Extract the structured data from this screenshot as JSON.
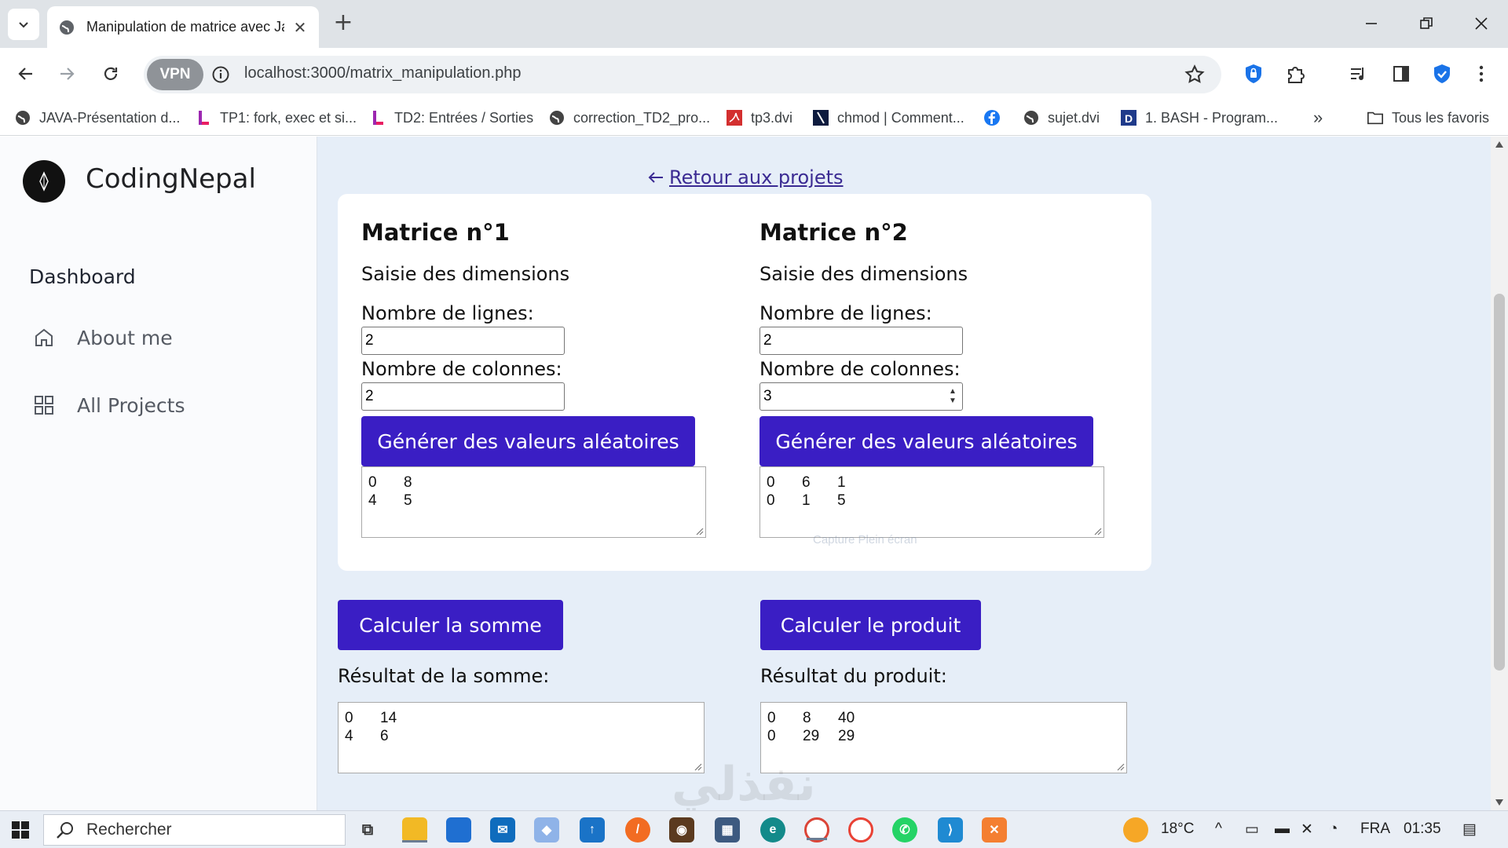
{
  "browser": {
    "tab_title": "Manipulation de matrice avec Já",
    "url": "localhost:3000/matrix_manipulation.php",
    "vpn_label": "VPN",
    "bookmarks": [
      {
        "label": "JAVA-Présentation d...",
        "icon": "globe-icon"
      },
      {
        "label": "TP1: fork, exec et si...",
        "icon": "bookmark-pink-icon"
      },
      {
        "label": "TD2: Entrées / Sorties",
        "icon": "bookmark-pink-icon"
      },
      {
        "label": "correction_TD2_pro...",
        "icon": "globe-icon"
      },
      {
        "label": "tp3.dvi",
        "icon": "pdf-icon"
      },
      {
        "label": "chmod | Comment...",
        "icon": "backslash-icon"
      },
      {
        "label": "",
        "icon": "facebook-icon"
      },
      {
        "label": "sujet.dvi",
        "icon": "globe-icon"
      },
      {
        "label": "1. BASH - Program...",
        "icon": "d-icon"
      }
    ],
    "more_bookmarks": "»",
    "all_favorites": "Tous les favoris"
  },
  "sidebar": {
    "brand": "CodingNepal",
    "heading": "Dashboard",
    "items": [
      {
        "label": "About me",
        "icon": "home-icon"
      },
      {
        "label": "All Projects",
        "icon": "grid-icon"
      }
    ]
  },
  "main": {
    "back_link": "Retour aux projets",
    "matrix1": {
      "title": "Matrice n°1",
      "subtitle": "Saisie des dimensions",
      "rows_label": "Nombre de lignes:",
      "rows_value": "2",
      "cols_label": "Nombre de colonnes:",
      "cols_value": "2",
      "generate_label": "Générer des valeurs aléatoires",
      "values": [
        [
          "0",
          "8"
        ],
        [
          "4",
          "5"
        ]
      ]
    },
    "matrix2": {
      "title": "Matrice n°2",
      "subtitle": "Saisie des dimensions",
      "rows_label": "Nombre de lignes:",
      "rows_value": "2",
      "cols_label": "Nombre de colonnes:",
      "cols_value": "3",
      "generate_label": "Générer des valeurs aléatoires",
      "values": [
        [
          "0",
          "6",
          "1"
        ],
        [
          "0",
          "1",
          "5"
        ]
      ]
    },
    "sum_button": "Calculer la somme",
    "product_button": "Calculer le produit",
    "sum_label": "Résultat de la somme:",
    "product_label": "Résultat du produit:",
    "sum_result": [
      [
        "0",
        "14"
      ],
      [
        "4",
        "6"
      ]
    ],
    "product_result": [
      [
        "0",
        "8",
        "40"
      ],
      [
        "0",
        "29",
        "29"
      ]
    ],
    "overlay_text": "Capture Plein écran"
  },
  "watermark": "نفذلي",
  "taskbar": {
    "search_placeholder": "Rechercher",
    "weather": "18°C",
    "language": "FRA",
    "time": "01:35"
  }
}
